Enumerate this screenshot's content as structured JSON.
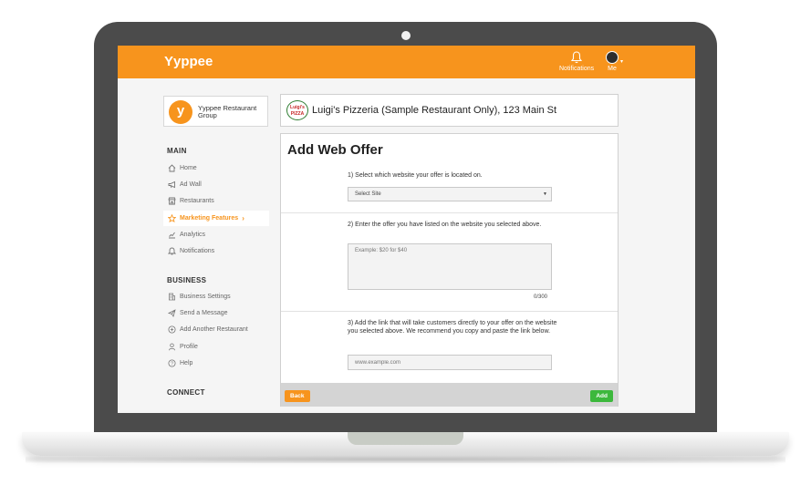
{
  "app": {
    "name": "Yyppee"
  },
  "topbar": {
    "notifications_label": "Notifications",
    "me_label": "Me"
  },
  "org": {
    "logo_letter": "y",
    "name": "Yyppee Restaurant Group"
  },
  "sidebar": {
    "main_title": "MAIN",
    "main_items": [
      {
        "label": "Home",
        "icon": "home-icon"
      },
      {
        "label": "Ad Wall",
        "icon": "megaphone-icon"
      },
      {
        "label": "Restaurants",
        "icon": "storefront-icon"
      },
      {
        "label": "Marketing Features",
        "icon": "star-icon",
        "active": true
      },
      {
        "label": "Analytics",
        "icon": "chart-icon"
      },
      {
        "label": "Notifications",
        "icon": "bell-icon"
      }
    ],
    "business_title": "BUSINESS",
    "business_items": [
      {
        "label": "Business Settings",
        "icon": "building-icon"
      },
      {
        "label": "Send a Message",
        "icon": "paper-plane-icon"
      },
      {
        "label": "Add Another Restaurant",
        "icon": "plus-circle-icon"
      },
      {
        "label": "Profile",
        "icon": "user-icon"
      },
      {
        "label": "Help",
        "icon": "help-icon"
      }
    ],
    "connect_title": "CONNECT"
  },
  "restaurant": {
    "logo_text_1": "Luigi's",
    "logo_text_2": "PIZZA",
    "name": "Luigi's Pizzeria (Sample Restaurant Only), 123 Main St"
  },
  "form": {
    "title": "Add Web Offer",
    "step1": "1) Select which website your offer is located on.",
    "select_value": "Select Site",
    "step2": "2) Enter the offer you have listed on the website you selected above.",
    "offer_placeholder": "Example: $20 for $40",
    "counter": "0/300",
    "step3": "3) Add the link that will take customers directly to your offer on the website you selected above. We recommend you copy and paste the link below.",
    "url_placeholder": "www.example.com",
    "back_label": "Back",
    "add_label": "Add"
  },
  "colors": {
    "brand": "#f7941d",
    "add_button": "#3cb83c",
    "bezel": "#4b4b4b"
  }
}
